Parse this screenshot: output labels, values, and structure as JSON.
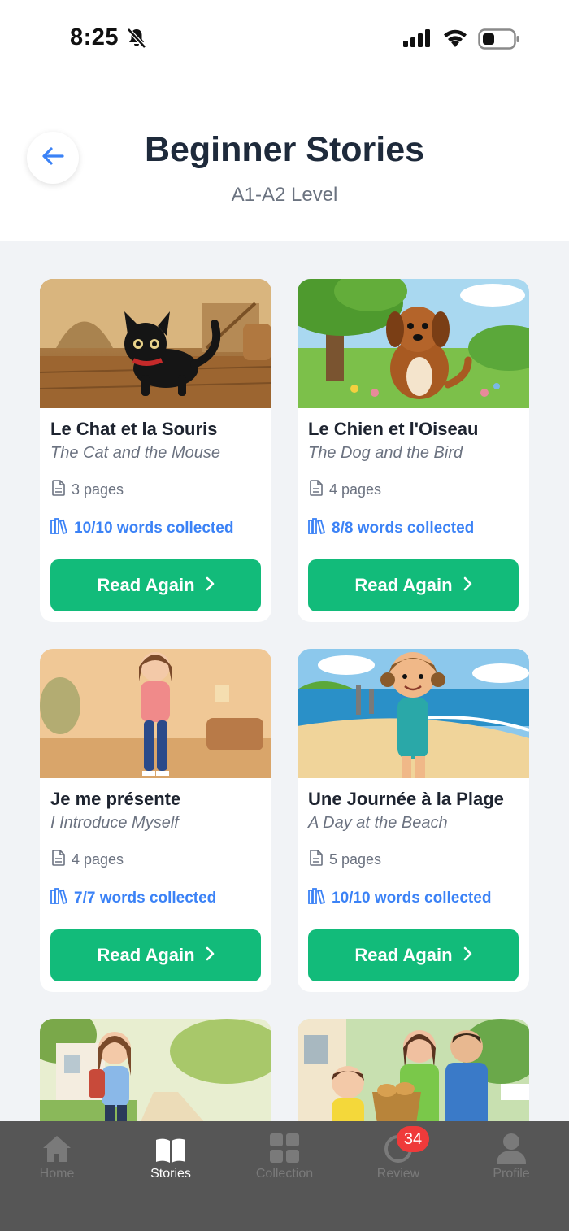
{
  "status_bar": {
    "time": "8:25",
    "icons": [
      "bell-slash-icon",
      "signal-icon",
      "wifi-icon",
      "battery-icon"
    ]
  },
  "header": {
    "back_icon": "arrow-left-icon",
    "title": "Beginner Stories",
    "subtitle": "A1-A2 Level"
  },
  "stories": [
    {
      "title": "Le Chat et la Souris",
      "subtitle": "The Cat and the Mouse",
      "pages": "3 pages",
      "words": "10/10 words collected",
      "button": "Read Again"
    },
    {
      "title": "Le Chien et l'Oiseau",
      "subtitle": "The Dog and the Bird",
      "pages": "4 pages",
      "words": "8/8 words collected",
      "button": "Read Again"
    },
    {
      "title": "Je me présente",
      "subtitle": "I Introduce Myself",
      "pages": "4 pages",
      "words": "7/7 words collected",
      "button": "Read Again"
    },
    {
      "title": "Une Journée à la Plage",
      "subtitle": "A Day at the Beach",
      "pages": "5 pages",
      "words": "10/10 words collected",
      "button": "Read Again"
    }
  ],
  "colors": {
    "accent_green": "#12bb7a",
    "link_blue": "#3b82f6",
    "title_dark": "#1e2a3b",
    "tabbar_bg": "#565656",
    "badge_red": "#ef3a3a"
  },
  "tabbar": {
    "tabs": [
      {
        "label": "Home",
        "icon": "home-icon",
        "active": false
      },
      {
        "label": "Stories",
        "icon": "book-icon",
        "active": true
      },
      {
        "label": "Collection",
        "icon": "grid-icon",
        "active": false
      },
      {
        "label": "Review",
        "icon": "review-icon",
        "active": false,
        "badge": "34"
      },
      {
        "label": "Profile",
        "icon": "person-icon",
        "active": false
      }
    ]
  }
}
